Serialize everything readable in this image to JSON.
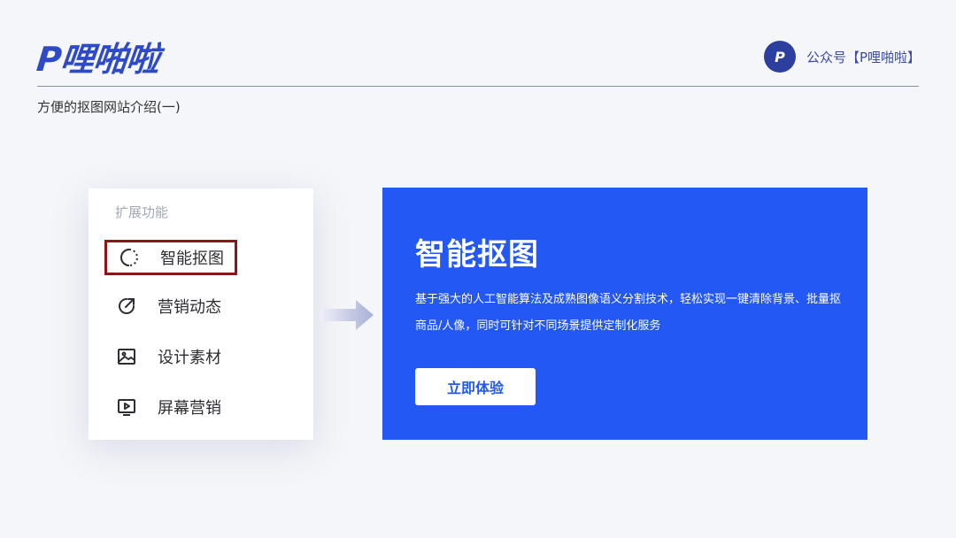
{
  "header": {
    "logo_text": "P哩啪啦",
    "account_avatar_text": "P",
    "account_label": "公众号【P哩啪啦】"
  },
  "subtitle": "方便的抠图网站介绍(一)",
  "menu": {
    "heading": "扩展功能",
    "items": [
      {
        "label": "智能抠图",
        "icon": "smart-cutout-icon",
        "selected": true
      },
      {
        "label": "营销动态",
        "icon": "share-arrow-icon",
        "selected": false
      },
      {
        "label": "设计素材",
        "icon": "image-icon",
        "selected": false
      },
      {
        "label": "屏幕营销",
        "icon": "screen-play-icon",
        "selected": false
      }
    ]
  },
  "promo": {
    "title": "智能抠图",
    "description": "基于强大的人工智能算法及成熟图像语义分割技术，轻松实现一键清除背景、批量抠商品/人像，同时可针对不同场景提供定制化服务",
    "button_label": "立即体验"
  },
  "colors": {
    "brand": "#2f4ac6",
    "promo_bg": "#2358f5",
    "selected_border": "#8a1616"
  }
}
